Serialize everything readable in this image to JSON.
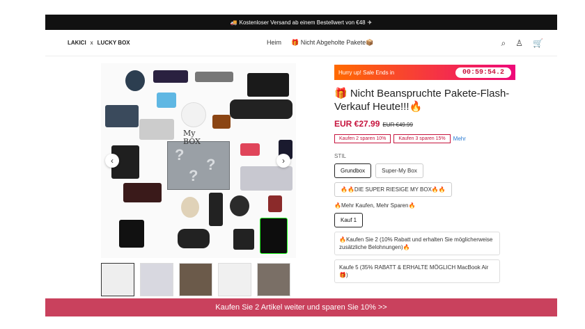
{
  "announcement": {
    "emoji": "🚚",
    "text": "Kostenloser Versand ab einem Bestellwert von €48",
    "icon": "✈"
  },
  "brand": {
    "left": "LAKICI",
    "sep": "x",
    "right": "LUCKY BOX"
  },
  "nav": [
    {
      "label": "Heim"
    },
    {
      "label": "🎁 Nicht Abgeholte Pakete📦"
    }
  ],
  "icons": {
    "search": "⌕",
    "account": "♙",
    "cart": "🛒"
  },
  "promo": {
    "text": "Hurry up! Sale Ends in",
    "timer": "00:59:54.2"
  },
  "product": {
    "title": "🎁 Nicht Beanspruchte Pakete-Flash-Verkauf Heute!!!🔥",
    "price": "EUR €27.99",
    "compare": "EUR €49.99",
    "discounts": [
      "Kaufen 2 sparen 10%",
      "Kaufen 3 sparen 15%"
    ],
    "more": "Mehr"
  },
  "style": {
    "label": "STIL",
    "options": [
      "Grundbox",
      "Super-My Box",
      "🔥🔥DIE SUPER RIESIGE MY BOX🔥🔥"
    ],
    "selected": "Grundbox"
  },
  "bundle": {
    "label": "🔥Mehr Kaufen, Mehr Sparen🔥",
    "option": "Kauf 1",
    "items": [
      "🔥Kaufen Sie 2 (10% Rabatt und erhalten Sie möglicherweise zusätzliche Belohnungen)🔥",
      "Kaufe 5 (35% RABATT & ERHALTE MÖGLICH MacBook Air 🎁)"
    ]
  },
  "gallery": {
    "box_text": "My BOX",
    "prev": "‹",
    "next": "›"
  },
  "banner": {
    "text": "Kaufen Sie 2 Artikel weiter und sparen Sie 10%  >>"
  }
}
